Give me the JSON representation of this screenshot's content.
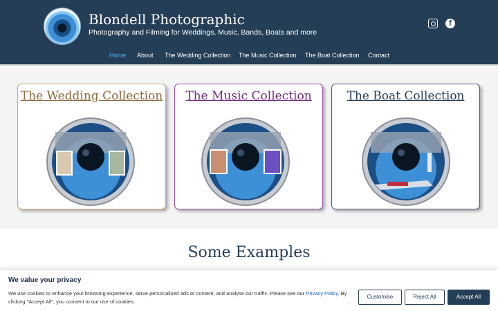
{
  "site": {
    "title": "Blondell Photographic",
    "tagline": "Photography and Filming for Weddings, Music, Bands, Boats and more"
  },
  "social": {
    "icons": [
      "instagram-icon",
      "facebook-icon"
    ],
    "facebook_glyph": "f"
  },
  "nav": {
    "items": [
      "Home",
      "About",
      "The Wedding Collection",
      "The Music Collection",
      "The Boat Collection",
      "Contact"
    ],
    "active": "Home"
  },
  "collections": [
    {
      "title": "The Wedding Collection",
      "color": "#8a6a3e",
      "border": "#c9a877"
    },
    {
      "title": "The Music Collection",
      "color": "#6d2a7a",
      "border": "#9a4ea8"
    },
    {
      "title": "The Boat Collection",
      "color": "#253e57",
      "border": "#4a5a6c"
    }
  ],
  "examples": {
    "title": "Some Examples"
  },
  "cookie": {
    "title": "We value your privacy",
    "text_before": "We use cookies to enhance your browsing experience, serve personalised ads or content, and analyse our traffic. Please see our ",
    "link": "Privacy Policy",
    "text_after": ". By clicking \"Accept All\", you consent to our use of cookies.",
    "buttons": {
      "customise": "Customise",
      "reject": "Reject All",
      "accept": "Accept All"
    }
  },
  "colors": {
    "header_bg": "#253e57",
    "nav_active": "#4fb4e8",
    "accent": "#253e57"
  }
}
